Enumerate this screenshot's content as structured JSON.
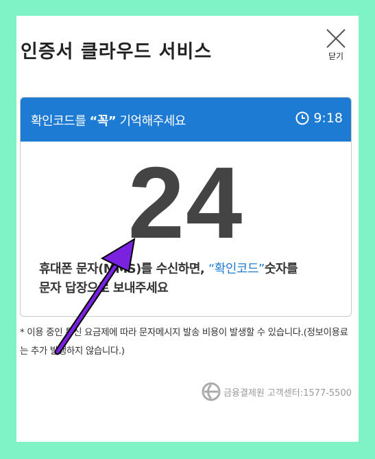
{
  "title": "인증서 클라우드 서비스",
  "close_label": "닫기",
  "header": {
    "prefix": "확인코드를 ",
    "emphasis": "“꼭”",
    "suffix": " 기억해주세요",
    "timer": "9:18"
  },
  "code": "24",
  "instruction": {
    "part1": "휴대폰 문자(MMS)를 수신하면, ",
    "highlight": "“확인코드”",
    "part2": "숫자를",
    "line2": "문자 답장으로 보내주세요"
  },
  "note": "* 이용 중인 통신 요금제에 따라 문자메시지 발송 비용이 발생할 수 있습니다.(정보이용료는 추가 발생하지 않습니다.)",
  "footer": {
    "org": "금융결제원",
    "support": "고객센터:1577-5500"
  },
  "colors": {
    "accent": "#1e7bd3",
    "background": "#7ff2c6",
    "annotation": "#7b22e0"
  }
}
